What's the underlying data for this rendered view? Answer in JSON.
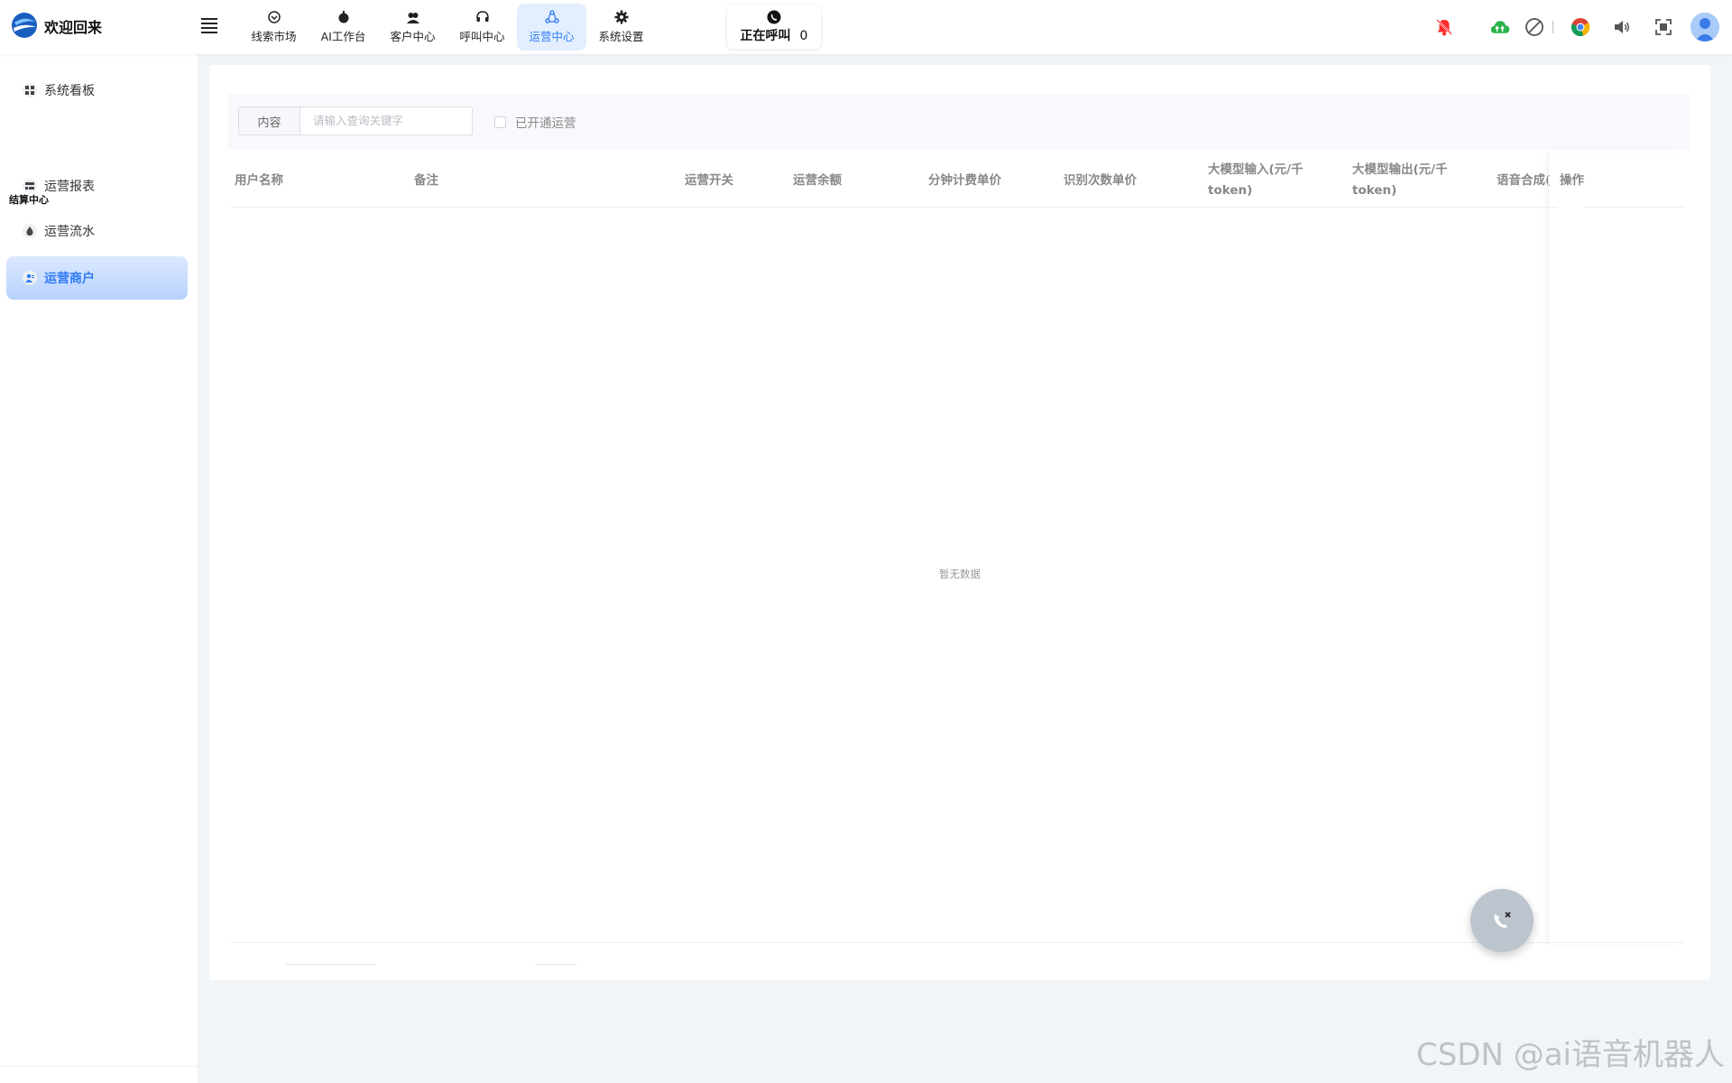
{
  "header": {
    "brand": "欢迎回来",
    "nav": [
      {
        "label": "线索市场",
        "icon": "clue-icon"
      },
      {
        "label": "AI工作台",
        "icon": "robot-icon"
      },
      {
        "label": "客户中心",
        "icon": "users-icon"
      },
      {
        "label": "呼叫中心",
        "icon": "headset-icon"
      },
      {
        "label": "运营中心",
        "icon": "operation-icon",
        "active": true
      },
      {
        "label": "系统设置",
        "icon": "gear-icon"
      }
    ],
    "calling": {
      "label": "正在呼叫",
      "count": "0"
    }
  },
  "sidebar": {
    "top_item": "系统看板",
    "group_title": "结算中心",
    "items": [
      {
        "label": "运营报表"
      },
      {
        "label": "运营流水"
      },
      {
        "label": "运营商户",
        "active": true
      }
    ]
  },
  "filter": {
    "field_label": "内容",
    "placeholder": "请输入查询关键字",
    "checkbox_label": "已开通运营"
  },
  "table": {
    "columns": [
      "用户名称",
      "备注",
      "运营开关",
      "运营余额",
      "分钟计费单价",
      "识别次数单价",
      "大模型输入(元/千token)",
      "大模型输出(元/千token)",
      "语音合成(",
      "操作"
    ],
    "empty_text": "暂无数据"
  },
  "watermark": "CSDN @ai语音机器人",
  "colors": {
    "accent": "#2f7bf5",
    "active_bg": "#e3efff",
    "bell": "#ff2a2a",
    "cloud": "#29b34a"
  }
}
